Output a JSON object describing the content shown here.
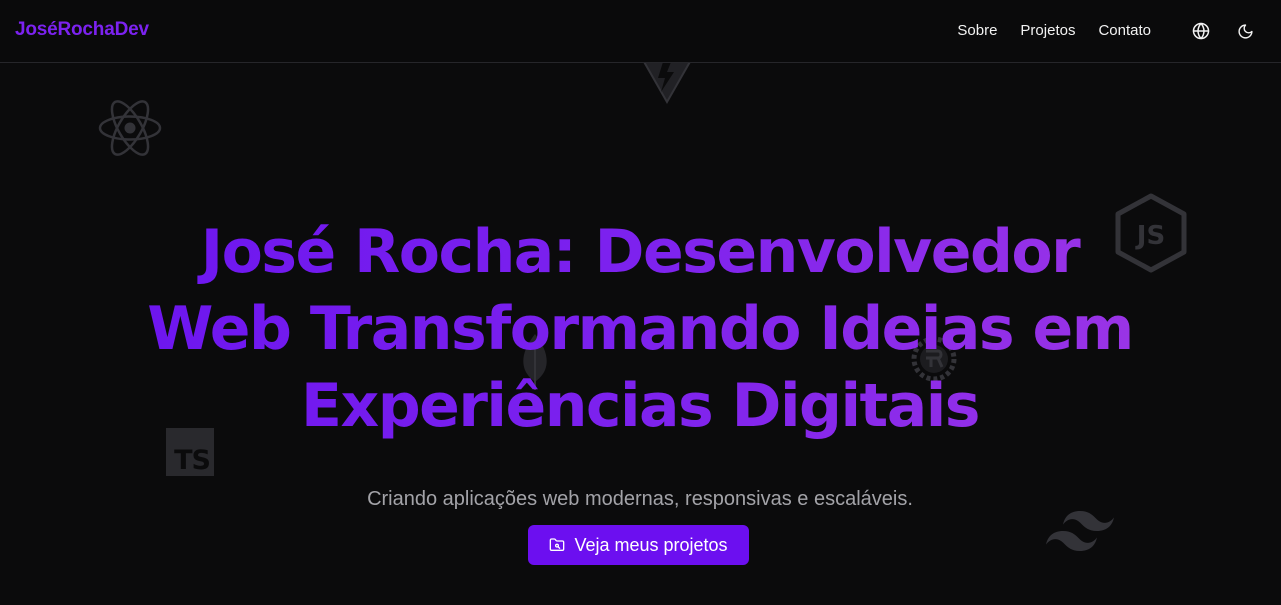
{
  "navbar": {
    "brand": "JoséRochaDev",
    "links": [
      {
        "label": "Sobre"
      },
      {
        "label": "Projetos"
      },
      {
        "label": "Contato"
      }
    ],
    "language_icon": "globe-icon",
    "theme_icon": "moon-icon"
  },
  "hero": {
    "title": "José Rocha: Desenvolvedor Web Transformando Ideias em Experiências Digitais",
    "subtitle": "Criando aplicações web modernas, responsivas e escaláveis.",
    "cta": {
      "label": "Veja meus projetos",
      "icon": "folder-icon"
    },
    "background_icons": [
      "react-icon",
      "vite-icon",
      "nodejs-icon",
      "mongodb-icon",
      "rust-icon",
      "typescript-icon",
      "tailwind-icon"
    ],
    "ts_badge_text": "TS",
    "js_badge_text": "JS"
  },
  "colors": {
    "accent": "#6c0ff0",
    "title_gradient_start": "#6d16ef",
    "title_gradient_end": "#9a34e6",
    "background": "#0b0b0c"
  }
}
